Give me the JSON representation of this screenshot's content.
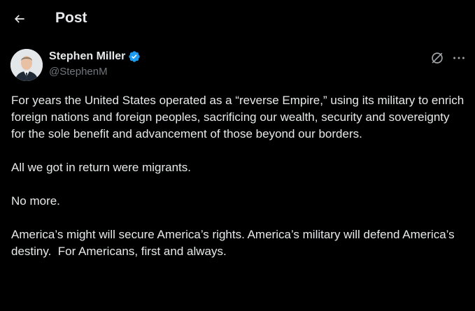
{
  "header": {
    "back_icon": "arrow-left-icon",
    "title": "Post"
  },
  "author": {
    "display_name": "Stephen Miller",
    "handle": "@StephenM",
    "verified": true,
    "verified_color": "#1d9bf0"
  },
  "actions": {
    "grok_icon": "grok-icon",
    "more_icon": "more-horizontal-icon"
  },
  "post": {
    "paragraphs": [
      "For years the United States operated as a “reverse Empire,” using its military to enrich foreign nations and foreign peoples, sacrificing our wealth, security and sovereignty for the sole benefit and advancement of those beyond our borders.",
      "All we got in return were migrants.",
      "No more.",
      "America’s might will secure America’s rights. America’s military will defend America’s destiny.  For Americans, first and always."
    ]
  },
  "colors": {
    "background": "#000000",
    "text": "#e7e9ea",
    "secondary_text": "#71767b",
    "accent": "#1d9bf0"
  }
}
